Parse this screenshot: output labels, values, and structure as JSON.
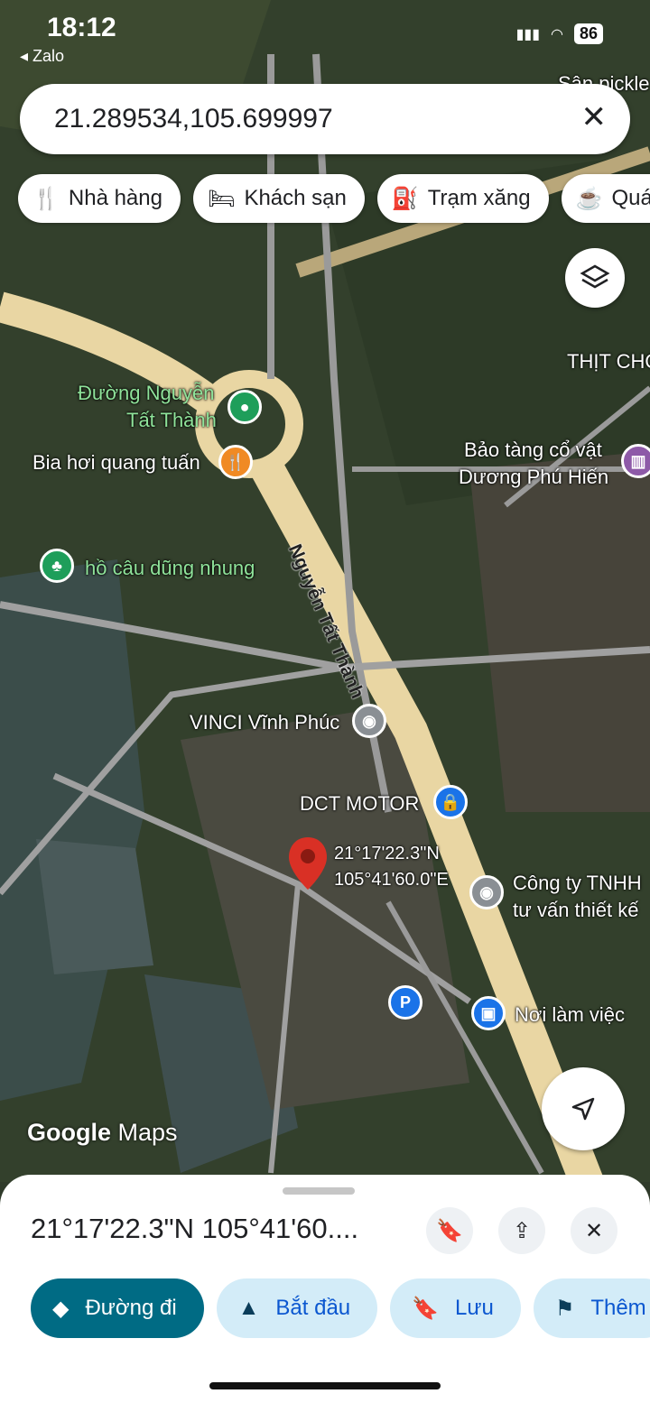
{
  "status": {
    "time": "18:12",
    "back_app": "◂ Zalo",
    "battery": "86"
  },
  "search": {
    "query": "21.289534,105.699997",
    "clear_icon": "close-icon"
  },
  "chips": [
    {
      "icon": "fork-knife-icon",
      "label": "Nhà hàng"
    },
    {
      "icon": "bed-icon",
      "label": "Khách sạn"
    },
    {
      "icon": "gas-station-icon",
      "label": "Trạm xăng"
    },
    {
      "icon": "coffee-icon",
      "label": "Quán"
    }
  ],
  "map": {
    "top_right_label": "Sân pickle",
    "labels": {
      "thit_cho": "THỊT CHÓ",
      "duong_nguyen_1": "Đường Nguyễn",
      "duong_nguyen_2": "Tất Thành",
      "bia_hoi": "Bia hơi quang tuấn",
      "bao_tang_1": "Bảo tàng cổ vật",
      "bao_tang_2": "Dương Phú Hiến",
      "ho_cau": "hồ câu dũng nhung",
      "vinci": "VINCI Vĩnh Phúc",
      "dct": "DCT MOTOR",
      "cong_ty_1": "Công ty TNHH",
      "cong_ty_2": "tư vấn thiết kế",
      "noi_lam_viec": "Nơi làm việc",
      "pin_lat": "21°17'22.3\"N",
      "pin_lng": "105°41'60.0\"E"
    },
    "road_name": "Nguyễn Tất Thành",
    "watermark_google": "Google",
    "watermark_maps": " Maps",
    "colors": {
      "road": "#e9d6a3",
      "green_label": "#8fe39a",
      "pin": "#d93025",
      "orange_poi": "#f08a24",
      "green_poi": "#1e9e5a",
      "blue_poi": "#1a73e8",
      "gray_poi": "#8a8f94"
    }
  },
  "sheet": {
    "title": "21°17'22.3\"N 105°41'60....",
    "buttons": {
      "directions": "Đường đi",
      "start": "Bắt đầu",
      "save": "Lưu",
      "more": "Thêm"
    }
  }
}
